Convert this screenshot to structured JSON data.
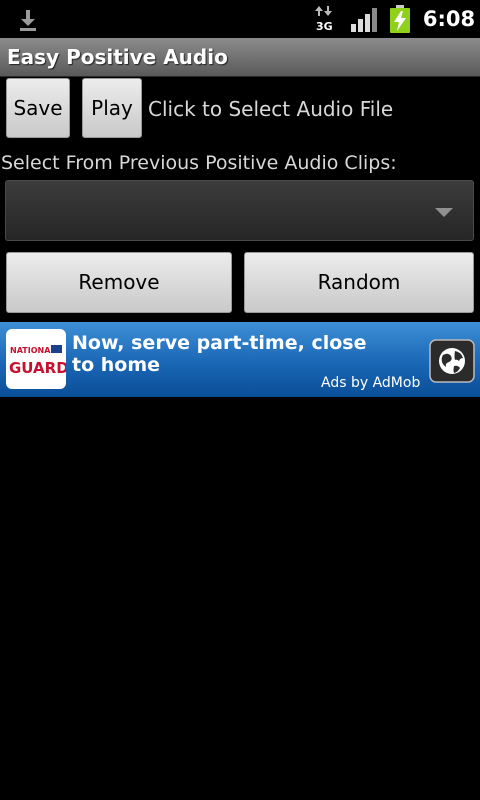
{
  "status_bar": {
    "time": "6:08",
    "network_label": "3G",
    "icons": [
      "download-icon",
      "network-3g-icon",
      "signal-icon",
      "battery-charging-icon"
    ]
  },
  "app": {
    "title": "Easy Positive Audio"
  },
  "controls": {
    "save_label": "Save",
    "play_label": "Play",
    "select_file_text": "Click to Select Audio File",
    "clips_label": "Select From Previous Positive Audio Clips:",
    "spinner_value": "",
    "remove_label": "Remove",
    "random_label": "Random"
  },
  "ad": {
    "logo_text_top": "NATIONAL",
    "logo_text_bottom": "GUARD",
    "headline": "Now, serve part-time, close to home",
    "attribution": "Ads by AdMob",
    "icon": "globe-icon"
  },
  "colors": {
    "ad_background": "#1a67b5",
    "logo_red": "#c8102e",
    "button_face": "#dcdcdc",
    "title_bar": "#6e6e6e"
  }
}
